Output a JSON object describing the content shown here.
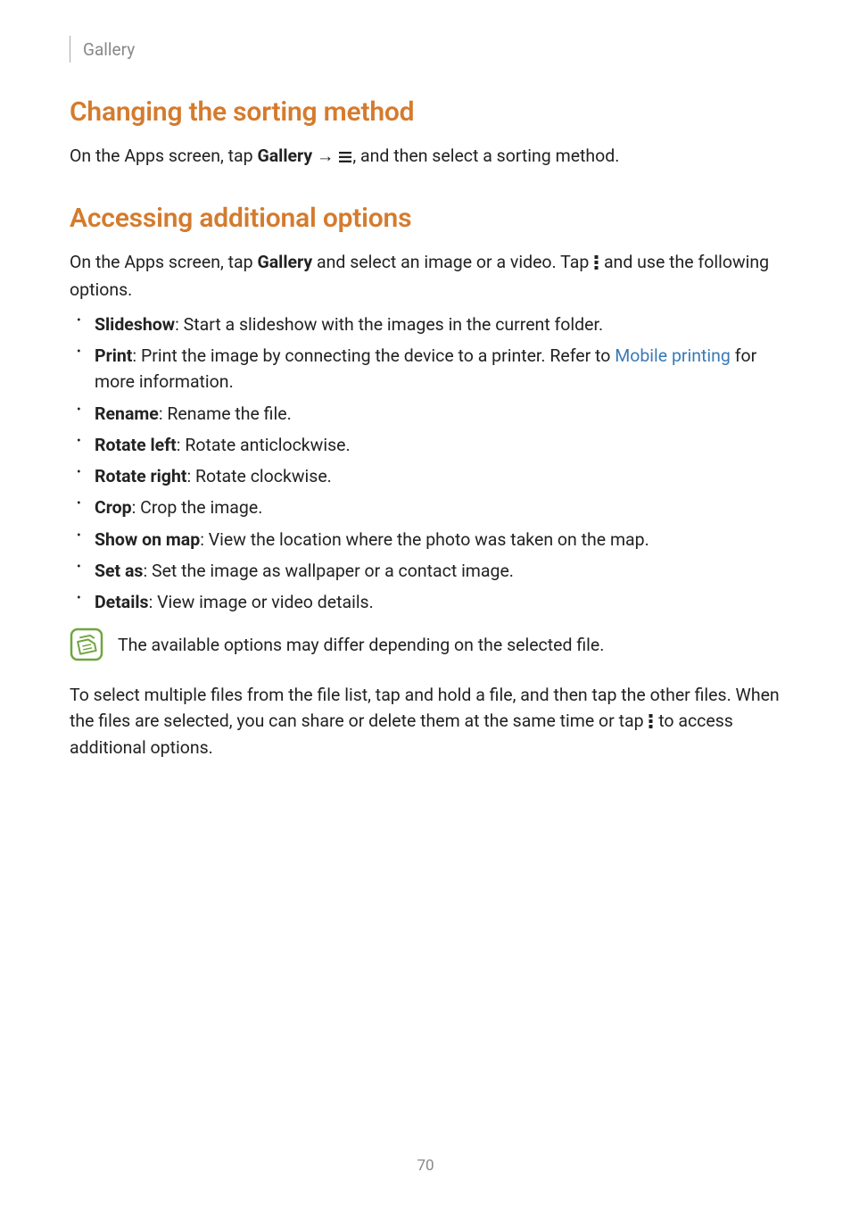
{
  "header": {
    "section": "Gallery"
  },
  "sorting": {
    "title": "Changing the sorting method",
    "text_part1": "On the Apps screen, tap ",
    "text_bold_gallery": "Gallery",
    "text_arrow": " → ",
    "text_part2": ", and then select a sorting method."
  },
  "options": {
    "title": "Accessing additional options",
    "intro_part1": "On the Apps screen, tap ",
    "intro_bold_gallery": "Gallery",
    "intro_part2": " and select an image or a video. Tap ",
    "intro_part3": " and use the following options.",
    "items": [
      {
        "label": "Slideshow",
        "desc": ": Start a slideshow with the images in the current folder."
      },
      {
        "label": "Print",
        "desc_pre": ": Print the image by connecting the device to a printer. Refer to ",
        "link": "Mobile printing",
        "desc_post": " for more information."
      },
      {
        "label": "Rename",
        "desc": ": Rename the file."
      },
      {
        "label": "Rotate left",
        "desc": ": Rotate anticlockwise."
      },
      {
        "label": "Rotate right",
        "desc": ": Rotate clockwise."
      },
      {
        "label": "Crop",
        "desc": ": Crop the image."
      },
      {
        "label": "Show on map",
        "desc": ": View the location where the photo was taken on the map."
      },
      {
        "label": "Set as",
        "desc": ": Set the image as wallpaper or a contact image."
      },
      {
        "label": "Details",
        "desc": ": View image or video details."
      }
    ],
    "note": "The available options may differ depending on the selected file.",
    "multi_part1": "To select multiple files from the file list, tap and hold a file, and then tap the other files. When the files are selected, you can share or delete them at the same time or tap ",
    "multi_part2": " to access additional options."
  },
  "page_number": "70"
}
